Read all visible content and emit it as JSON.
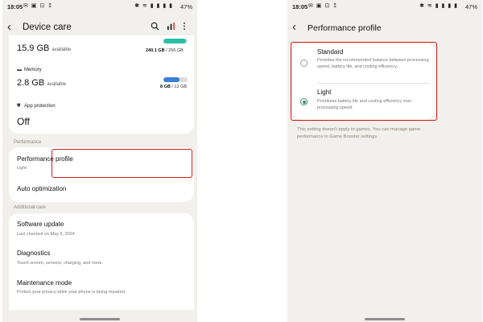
{
  "colors": {
    "highlight": "#d01c1c",
    "memory_bar": "#3b7fd6",
    "storage_bar": "#2bbfa6",
    "radio_accent": "#3f8c6a"
  },
  "status_bar": {
    "time": "18:05",
    "notification_icons": "✉ ▣ ⊡ ↥",
    "system_icons": "✱ ≋ ▮ ▮ ▮ ▮",
    "battery": "47%"
  },
  "left": {
    "header": {
      "title": "Device care",
      "icons": [
        "back-icon",
        "search-icon",
        "bar-chart-icon",
        "more-vert-icon"
      ]
    },
    "storage": {
      "value": "15.9 GB",
      "unit": "available",
      "used": "240.1 GB",
      "total": "/ 256 GB",
      "fill_fraction": 0.94
    },
    "memory": {
      "label": "Memory",
      "value": "2.8 GB",
      "unit": "available",
      "used": "8 GB",
      "total": "/ 12 GB",
      "fill_fraction": 0.67
    },
    "app_protection": {
      "label": "App protection",
      "value": "Off"
    },
    "performance_section": "Performance",
    "performance_profile": {
      "title": "Performance profile",
      "sub": "Light"
    },
    "auto_optimization": {
      "title": "Auto optimization"
    },
    "additional_section": "Additional care",
    "software_update": {
      "title": "Software update",
      "sub": "Last checked on May 6, 2024"
    },
    "diagnostics": {
      "title": "Diagnostics",
      "sub": "Touch screen, sensors, charging, and more."
    },
    "maintenance_mode": {
      "title": "Maintenance mode",
      "sub": "Protect your privacy while your phone is being repaired."
    }
  },
  "right": {
    "header": {
      "title": "Performance profile"
    },
    "options": [
      {
        "title": "Standard",
        "desc": "Provides the recommended balance between processing speed, battery life, and cooling efficiency.",
        "selected": false
      },
      {
        "title": "Light",
        "desc": "Prioritizes battery life and cooling efficiency over processing speed.",
        "selected": true
      }
    ],
    "note": "This setting doesn't apply to games. You can manage game performance in Game Booster settings."
  }
}
